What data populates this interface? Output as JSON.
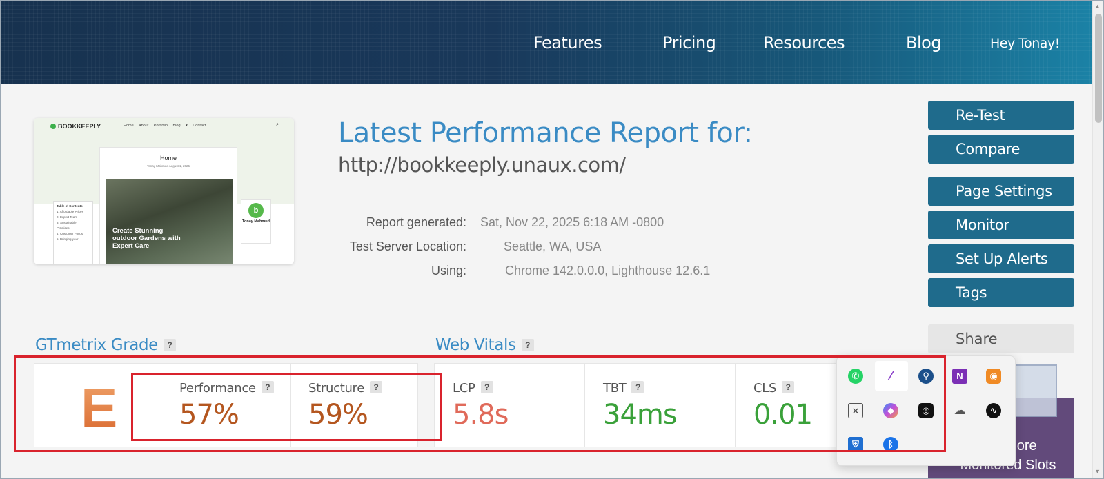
{
  "nav": {
    "features": "Features",
    "pricing": "Pricing",
    "resources": "Resources",
    "blog": "Blog",
    "greeting": "Hey Tonay!"
  },
  "thumbnail": {
    "logo": "BOOKKEEPLY",
    "nav_items": "Home About Portfolio Blog ▾ Contact",
    "card_title": "Home",
    "card_meta": "Tonay Mahmud   August 1, 2025",
    "hero_text": "Create Stunning outdoor Gardens with Expert Care",
    "toc_title": "Table of Contents",
    "toc_items": [
      "1. Affordable Prices",
      "2. Expert Team",
      "3. Sustainable Practices",
      "4. Customer Focus",
      "5. Bringing your"
    ],
    "author_initial": "b",
    "author_name": "Tonay Mahmud"
  },
  "report": {
    "title": "Latest Performance Report for:",
    "url": "http://bookkeeply.unaux.com/",
    "generated_label": "Report generated:",
    "generated_value": "Sat, Nov 22, 2025 6:18 AM -0800",
    "server_label": "Test Server Location:",
    "server_value": "Seattle, WA, USA",
    "using_label": "Using:",
    "using_value": "Chrome 142.0.0.0, Lighthouse 12.6.1"
  },
  "actions": {
    "retest": "Re-Test",
    "compare": "Compare",
    "page_settings": "Page Settings",
    "monitor": "Monitor",
    "alerts": "Set Up Alerts",
    "tags": "Tags",
    "share": "Share",
    "promo": "Get More Monitored Slots"
  },
  "grade": {
    "section_title": "GTmetrix Grade",
    "help": "?",
    "letter": "E",
    "performance_label": "Performance",
    "performance_value": "57%",
    "structure_label": "Structure",
    "structure_value": "59%"
  },
  "vitals": {
    "section_title": "Web Vitals",
    "help": "?",
    "lcp_label": "LCP",
    "lcp_value": "5.8s",
    "tbt_label": "TBT",
    "tbt_value": "34ms",
    "cls_label": "CLS",
    "cls_value": "0.01"
  },
  "tray_icons": [
    "whatsapp-icon",
    "pen-icon",
    "link-icon",
    "onenote-icon",
    "orange-app-icon",
    "blocked-chat-icon",
    "copilot-icon",
    "dark-app-icon",
    "cloud-icon",
    "pulse-icon",
    "defender-icon",
    "bluetooth-icon"
  ],
  "colors": {
    "accent_blue": "#3a8bc4",
    "button_teal": "#1f6b8c",
    "grade_orange": "#e07a3c",
    "value_orange": "#b4561f",
    "lcp_red": "#e06a5a",
    "good_green": "#3aa13a",
    "highlight_red": "#d9232d"
  }
}
